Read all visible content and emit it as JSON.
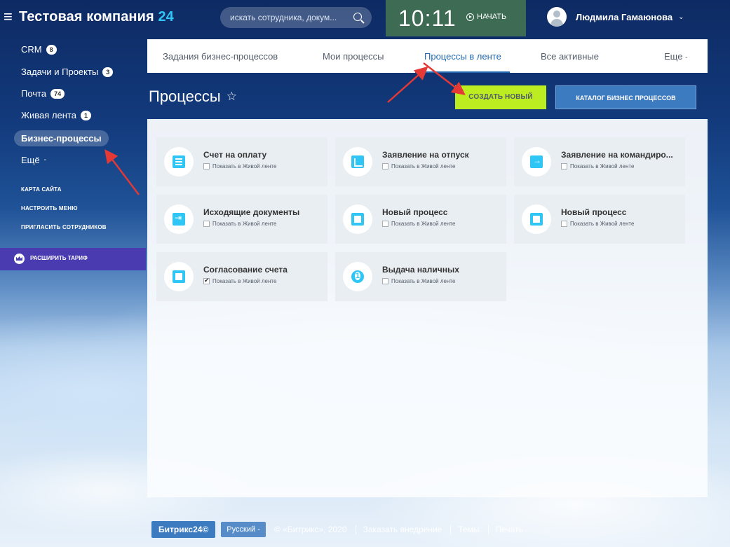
{
  "header": {
    "company_name": "Тестовая компания",
    "company_num": "24",
    "search_placeholder": "искать сотрудника, докум...",
    "clock": "10:11",
    "start_label": "НАЧАТЬ",
    "user_name": "Людмила Гамаюнова"
  },
  "sidebar": {
    "items": [
      {
        "label": "CRM",
        "badge": "8"
      },
      {
        "label": "Задачи и Проекты",
        "badge": "3"
      },
      {
        "label": "Почта",
        "badge": "74"
      },
      {
        "label": "Живая лента",
        "badge": "1"
      },
      {
        "label": "Бизнес-процессы"
      },
      {
        "label": "Ещё"
      }
    ],
    "links": [
      "КАРТА САЙТА",
      "НАСТРОИТЬ МЕНЮ",
      "ПРИГЛАСИТЬ СОТРУДНИКОВ"
    ],
    "tariff_label": "РАСШИРИТЬ ТАРИФ"
  },
  "tabs": [
    {
      "label": "Задания бизнес-процессов"
    },
    {
      "label": "Мои процессы"
    },
    {
      "label": "Процессы в ленте"
    },
    {
      "label": "Все активные"
    },
    {
      "label": "Еще"
    }
  ],
  "page": {
    "title": "Процессы",
    "create_button": "СОЗДАТЬ НОВЫЙ",
    "catalog_button": "КАТАЛОГ БИЗНЕС ПРОЦЕССОВ"
  },
  "cards": [
    {
      "title": "Счет на оплату",
      "checkbox_label": "Показать в Живой ленте",
      "checked": false,
      "icon": "document-icon"
    },
    {
      "title": "Заявление на отпуск",
      "checkbox_label": "Показать в Живой ленте",
      "checked": false,
      "icon": "edit-icon"
    },
    {
      "title": "Заявление на командиро...",
      "checkbox_label": "Показать в Живой ленте",
      "checked": false,
      "icon": "arrow-in-icon"
    },
    {
      "title": "Исходящие документы",
      "checkbox_label": "Показать в Живой ленте",
      "checked": false,
      "icon": "export-icon"
    },
    {
      "title": "Новый процесс",
      "checkbox_label": "Показать в Живой ленте",
      "checked": false,
      "icon": "square-icon"
    },
    {
      "title": "Новый процесс",
      "checkbox_label": "Показать в Живой ленте",
      "checked": false,
      "icon": "square-icon"
    },
    {
      "title": "Согласование счета",
      "checkbox_label": "Показать в Живой ленте",
      "checked": true,
      "icon": "square-icon"
    },
    {
      "title": "Выдача наличных",
      "checkbox_label": "Показать в Живой ленте",
      "checked": false,
      "icon": "coin-icon"
    }
  ],
  "footer": {
    "brand": "Битрикс24©",
    "language": "Русский",
    "copyright": "© «Битрикс», 2020",
    "order": "Заказать внедрение",
    "themes": "Темы",
    "print": "Печать"
  },
  "colors": {
    "accent_blue": "#2067b0",
    "create_green": "#bbed21",
    "icon_cyan": "#2fc6f6",
    "tariff_purple": "#4a3bb0",
    "arrow_red": "#e53935"
  }
}
